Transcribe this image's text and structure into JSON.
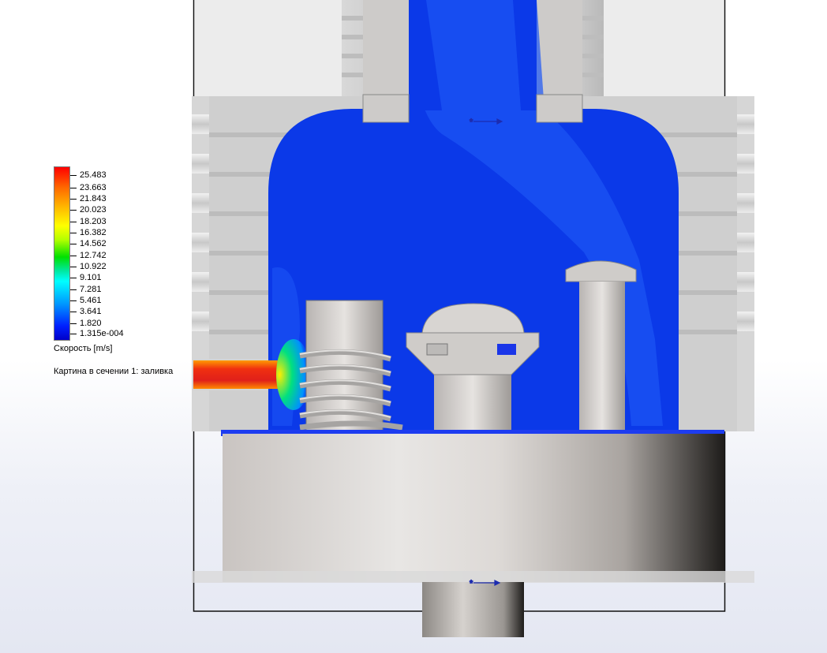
{
  "legend": {
    "ticks": [
      "25.483",
      "23.663",
      "21.843",
      "20.023",
      "18.203",
      "16.382",
      "14.562",
      "12.742",
      "10.922",
      "9.101",
      "7.281",
      "5.461",
      "3.641",
      "1.820",
      "1.315e-004"
    ],
    "title": "Скорость [m/s]",
    "colors": [
      "#ff0000",
      "#ff6a00",
      "#ffff00",
      "#00e000",
      "#00ffff",
      "#0000c8"
    ]
  },
  "plot_caption": "Картина в сечении 1: заливка",
  "scene": {
    "fluid_color": "#0b39e8",
    "jet_color": "#e6241c",
    "metal_color": "#d9d6d2"
  }
}
